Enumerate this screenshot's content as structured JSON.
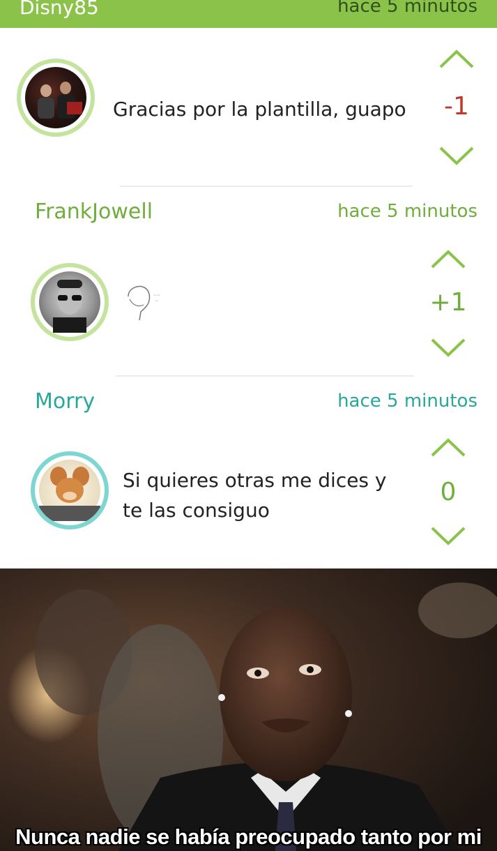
{
  "top_bar": {
    "user": "Disny85",
    "time": "hace 5 minutos"
  },
  "comments": [
    {
      "text": "Gracias por la plantilla, guapo",
      "score": "-1",
      "score_color": "#c0392b"
    },
    {
      "user": "FrankJowell",
      "time": "hace 5 minutos",
      "text": "",
      "score": "+1",
      "score_color": "#6fae3d"
    },
    {
      "user": "Morry",
      "time": "hace 5 minutos",
      "text_line1": "Si quieres otras me dices y",
      "text_line2": "te las consiguo",
      "score": "0",
      "score_color": "#6fae3d"
    }
  ],
  "meme": {
    "caption": "Nunca nadie se había preocupado tanto por mi"
  },
  "colors": {
    "accent": "#8bc34a",
    "username_green": "#6fae3d",
    "username_teal": "#27a89a",
    "negative": "#c0392b"
  },
  "icons": [
    "upvote-chevron-icon",
    "downvote-chevron-icon",
    "troll-face-sticker-icon"
  ]
}
